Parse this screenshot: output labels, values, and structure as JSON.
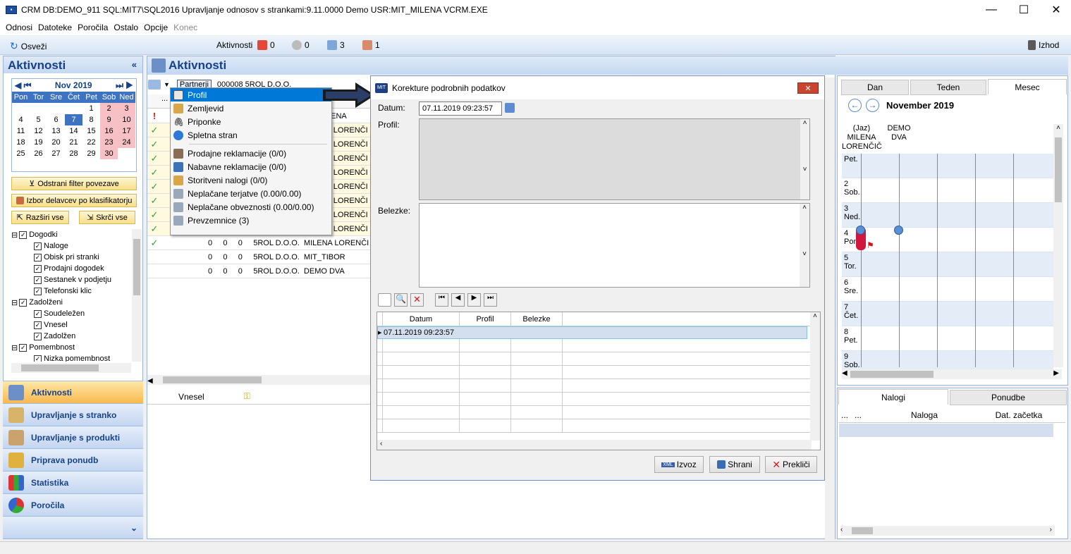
{
  "window": {
    "title": "CRM   DB:DEMO_911   SQL:MIT7\\SQL2016   Upravljanje odnosov s strankami:9.11.0000   Demo   USR:MIT_MILENA   VCRM.EXE"
  },
  "menubar": [
    "Odnosi",
    "Datoteke",
    "Poročila",
    "Ostalo",
    "Opcije",
    "Konec"
  ],
  "toolbar": {
    "refresh": "Osveži",
    "activities": "Aktivnosti",
    "c1": "0",
    "c2": "0",
    "c3": "3",
    "c4": "1",
    "exit": "Izhod"
  },
  "left": {
    "title": "Aktivnosti",
    "cal_month": "Nov 2019",
    "cal_days": [
      "Pon",
      "Tor",
      "Sre",
      "Čet",
      "Pet",
      "Sob",
      "Ned"
    ],
    "cal_weeks": [
      [
        "",
        "",
        "",
        "",
        "1",
        "2",
        "3"
      ],
      [
        "4",
        "5",
        "6",
        "7",
        "8",
        "9",
        "10"
      ],
      [
        "11",
        "12",
        "13",
        "14",
        "15",
        "16",
        "17"
      ],
      [
        "18",
        "19",
        "20",
        "21",
        "22",
        "23",
        "24"
      ],
      [
        "25",
        "26",
        "27",
        "28",
        "29",
        "30",
        ""
      ]
    ],
    "btn_filter": "Odstrani filter povezave",
    "btn_classif": "Izbor delavcev po klasifikatorju",
    "btn_expand": "Razširi vse",
    "btn_collapse": "Skrči vse",
    "tree": [
      {
        "label": "Dogodki",
        "lvl": 0
      },
      {
        "label": "Naloge",
        "lvl": 1
      },
      {
        "label": "Obisk pri stranki",
        "lvl": 1
      },
      {
        "label": "Prodajni dogodek",
        "lvl": 1
      },
      {
        "label": "Sestanek v podjetju",
        "lvl": 1
      },
      {
        "label": "Telefonski klic",
        "lvl": 1
      },
      {
        "label": "Zadolženi",
        "lvl": 0
      },
      {
        "label": "Soudeležen",
        "lvl": 1
      },
      {
        "label": "Vnesel",
        "lvl": 1
      },
      {
        "label": "Zadolžen",
        "lvl": 1
      },
      {
        "label": "Pomembnost",
        "lvl": 0
      },
      {
        "label": "Nizka pomembnost",
        "lvl": 1
      }
    ],
    "nav": [
      "Aktivnosti",
      "Upravljanje s stranko",
      "Upravljanje s produkti",
      "Priprava ponudb",
      "Statistika",
      "Poročila"
    ]
  },
  "main": {
    "title": "Aktivnosti",
    "partner_btn": "Partnerji",
    "partner_val": "000008 5ROL D.O.O.",
    "rows": [
      {
        "text": "LENA"
      },
      {
        "text": "A LORENČI"
      },
      {
        "text": "A LORENČI"
      },
      {
        "text": "A LORENČI"
      },
      {
        "text": "A LORENČI"
      },
      {
        "text": "A LORENČI"
      },
      {
        "text": "A LORENČI"
      },
      {
        "text": "A LORENČI"
      },
      {
        "text": "A LORENČI"
      },
      {
        "text": "0     0     0     5ROL D.O.O.  MILENA LORENČI"
      },
      {
        "text": "0     0     0     5ROL D.O.O.  MIT_TIBOR"
      },
      {
        "text": "0     0     0     5ROL D.O.O.  DEMO DVA"
      }
    ],
    "lower_col": "Vnesel",
    "more": "..."
  },
  "context_menu": [
    "Profil",
    "Zemljevid",
    "Priponke",
    "Spletna stran",
    "Prodajne reklamacije (0/0)",
    "Nabavne reklamacije (0/0)",
    "Storitveni nalogi (0/0)",
    "Neplačane terjatve (0.00/0.00)",
    "Neplačane obveznosti (0.00/0.00)",
    "Prevzemnice (3)"
  ],
  "dialog": {
    "title": "Korekture podrobnih podatkov",
    "datum_label": "Datum:",
    "datum_value": "07.11.2019 09:23:57",
    "profil_label": "Profil:",
    "belezke_label": "Belezke:",
    "cols": [
      "Datum",
      "Profil",
      "Belezke"
    ],
    "row1": "07.11.2019 09:23:57",
    "btn_export": "Izvoz",
    "btn_save": "Shrani",
    "btn_cancel": "Prekliči"
  },
  "right": {
    "tabs": [
      "Dan",
      "Teden",
      "Mesec"
    ],
    "month": "November 2019",
    "person1": "(Jaz)\nMILENA\nLORENČIČ",
    "person2": "DEMO\nDVA",
    "days": [
      {
        "n": "",
        "d": "Pet."
      },
      {
        "n": "2",
        "d": "Sob."
      },
      {
        "n": "3",
        "d": "Ned."
      },
      {
        "n": "4",
        "d": "Pon."
      },
      {
        "n": "5",
        "d": "Tor."
      },
      {
        "n": "6",
        "d": "Sre."
      },
      {
        "n": "7",
        "d": "Čet."
      },
      {
        "n": "8",
        "d": "Pet."
      },
      {
        "n": "9",
        "d": "Sob."
      }
    ],
    "tabs2": [
      "Nalogi",
      "Ponudbe"
    ],
    "cols2": [
      "...",
      "...",
      "Naloga",
      "Dat. začetka"
    ]
  }
}
